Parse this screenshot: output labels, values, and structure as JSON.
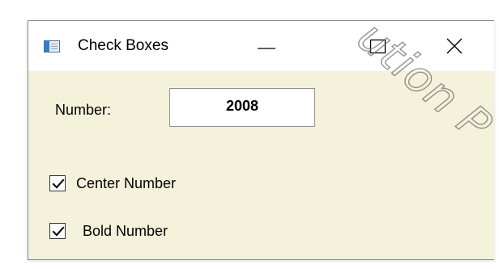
{
  "window": {
    "title": "Check Boxes",
    "background_color": "#f5f2dc"
  },
  "controls": {
    "minimize_icon": "minimize-icon",
    "maximize_icon": "maximize-icon",
    "close_icon": "close-icon"
  },
  "form": {
    "number_label": "Number:",
    "number_value": "2008",
    "checkboxes": [
      {
        "label": "Center Number",
        "checked": true
      },
      {
        "label": "Bold Number",
        "checked": true
      }
    ]
  }
}
